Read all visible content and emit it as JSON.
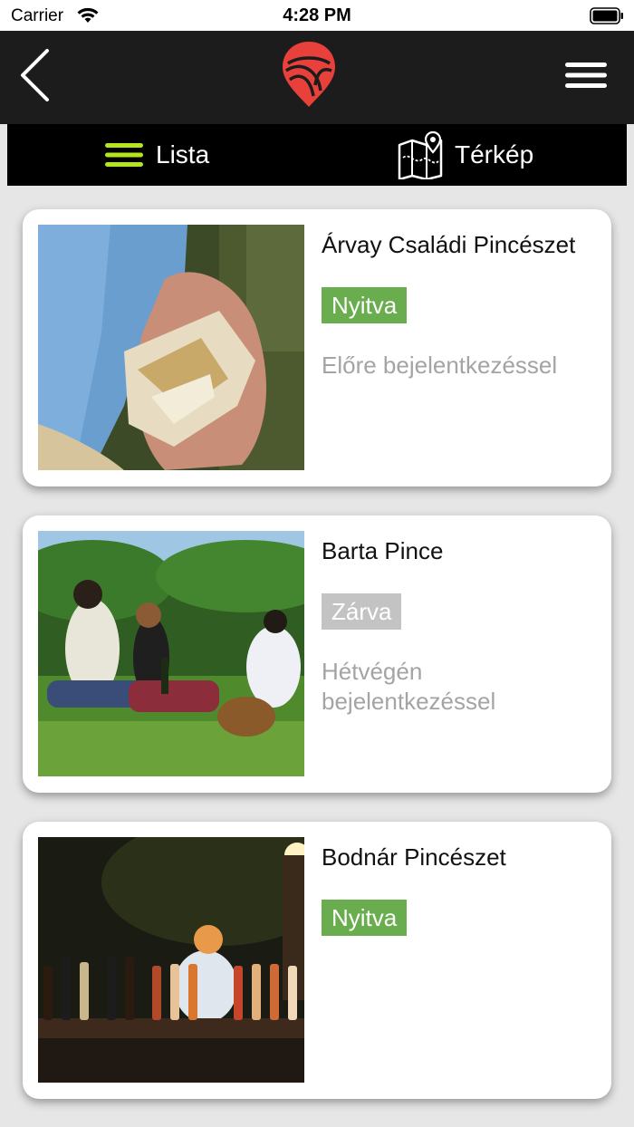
{
  "status_bar": {
    "carrier": "Carrier",
    "time": "4:28 PM"
  },
  "nav": {
    "back_icon": "chevron-left-icon",
    "logo_icon": "winery-pin-logo-icon",
    "menu_icon": "hamburger-menu-icon"
  },
  "tabs": [
    {
      "label": "Lista",
      "icon": "list-icon",
      "icon_color": "#b5e61d",
      "active": true
    },
    {
      "label": "Térkép",
      "icon": "map-icon",
      "active": false
    }
  ],
  "colors": {
    "open": "#6aad4f",
    "closed": "#c3c3c3",
    "logo": "#e8403b",
    "nav_bg": "#1c1c1c"
  },
  "wineries": [
    {
      "name": "Árvay Családi Pincészet",
      "status": "Nyitva",
      "status_type": "open",
      "note": "Előre bejelentkezéssel",
      "photo": "hand-holding-rock-photo"
    },
    {
      "name": "Barta Pince",
      "status": "Zárva",
      "status_type": "closed",
      "note": "Hétvégén bejelentkezéssel",
      "photo": "picnic-wine-tasting-photo"
    },
    {
      "name": "Bodnár Pincészet",
      "status": "Nyitva",
      "status_type": "open",
      "note": "",
      "photo": "wine-bottles-table-photo"
    }
  ]
}
